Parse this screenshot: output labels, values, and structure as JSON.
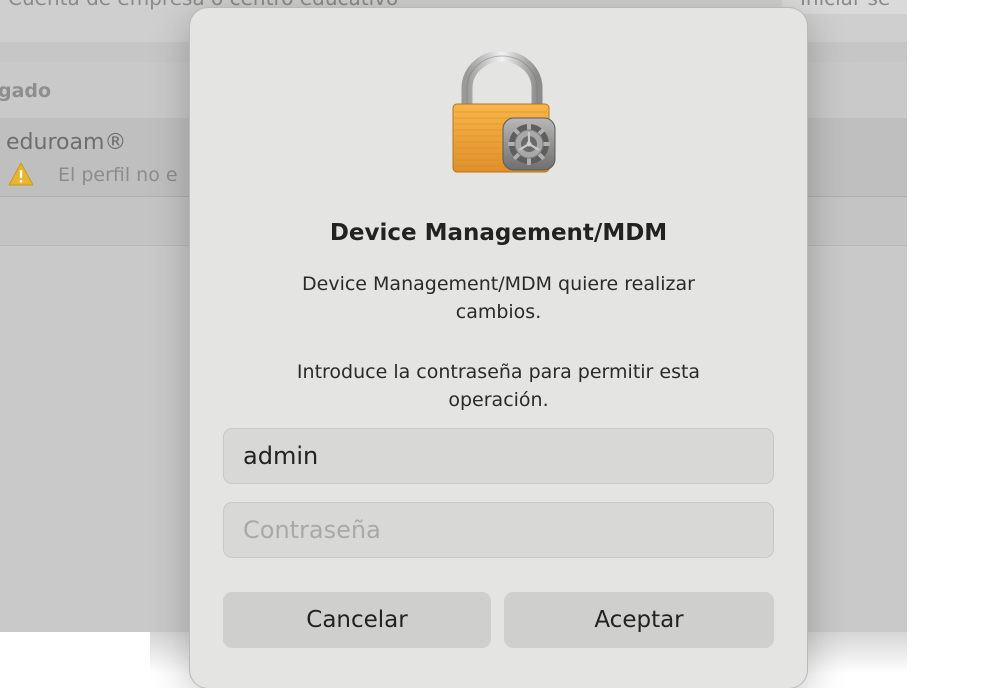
{
  "background": {
    "topbar_text": "Cuenta de empresa o centro educativo",
    "topbar_button": "Iniciar se",
    "section_label": "gado",
    "profile": {
      "name": "eduroam®",
      "status": "El perfil no e"
    }
  },
  "dialog": {
    "title": "Device Management/MDM",
    "message": "Device Management/MDM quiere realizar cambios.",
    "prompt": "Introduce la contraseña para permitir esta operación.",
    "username_value": "admin",
    "password_placeholder": "Contraseña",
    "cancel_label": "Cancelar",
    "accept_label": "Aceptar"
  },
  "icons": {
    "lock": "lock-with-gear-icon",
    "warning": "warning-triangle-icon"
  },
  "colors": {
    "dialog_bg": "#e4e4e2",
    "field_bg": "#d8d8d6",
    "button_bg": "#cfcfcd",
    "lock_body": "#f0a63a",
    "warning": "#e8b62c"
  }
}
